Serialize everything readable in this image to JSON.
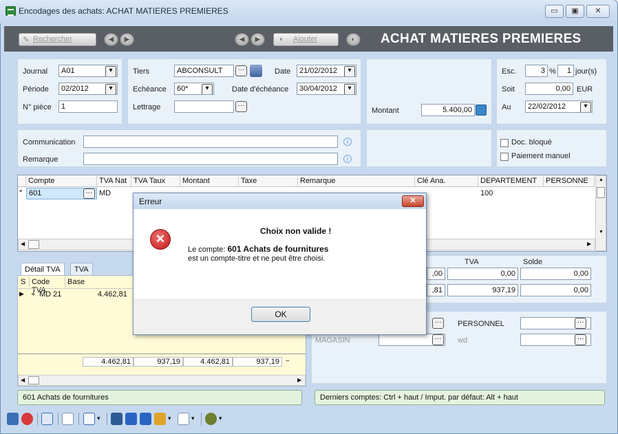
{
  "window": {
    "title": "Encodages des achats:  ACHAT MATIERES PREMIERES"
  },
  "toolbar": {
    "search_label": "Rechercher",
    "add_label": "Ajouter",
    "heading": "ACHAT MATIERES PREMIERES"
  },
  "form": {
    "journal_label": "Journal",
    "journal_value": "A01",
    "periode_label": "Période",
    "periode_value": "02/2012",
    "piece_label": "N° pièce",
    "piece_value": "1",
    "tiers_label": "Tiers",
    "tiers_value": "ABCONSULT",
    "echeance_label": "Echéance",
    "echeance_value": "60*",
    "lettrage_label": "Lettrage",
    "lettrage_value": "",
    "date_label": "Date",
    "date_value": "21/02/2012",
    "date_echeance_label": "Date d'échéance",
    "date_echeance_value": "30/04/2012",
    "montant_label": "Montant",
    "montant_value": "5.400,00",
    "esc_label": "Esc.",
    "esc_value": "3",
    "esc_unit": "%",
    "jour_value": "1",
    "jour_label": "jour(s)",
    "soit_label": "Soit",
    "soit_value": "0,00",
    "soit_unit": "EUR",
    "au_label": "Au",
    "au_value": "22/02/2012",
    "communication_label": "Communication",
    "remarque_label": "Remarque",
    "doc_bloque_label": "Doc. bloqué",
    "paiement_manuel_label": "Paiement manuel"
  },
  "grid": {
    "headers": [
      "Compte",
      "TVA Nat",
      "TVA Taux",
      "Montant",
      "Taxe",
      "Remarque",
      "Clé Ana.",
      "DEPARTEMENT",
      "PERSONNE"
    ],
    "row": {
      "marker": "*",
      "compte": "601",
      "tva_nat": "MD",
      "departement": "100"
    }
  },
  "tva_panel": {
    "tabs": [
      "Détail TVA",
      "TVA"
    ],
    "headers": [
      "S",
      "Code TVA",
      "Base"
    ],
    "row": {
      "s": "+",
      "code": "MD 21",
      "base": "4.462,81"
    },
    "totals": [
      "4.462,81",
      "937,19",
      "4.462,81",
      "937,19"
    ]
  },
  "summary": {
    "tva_label": "TVA",
    "solde_label": "Solde",
    "r1": [
      ",00",
      "0,00",
      "0,00"
    ],
    "r2": [
      ",81",
      "937,19",
      "0,00"
    ]
  },
  "analytics": {
    "magasin_label": "MAGASIN",
    "wd_label": "wd",
    "personnel_label": "PERSONNEL"
  },
  "status": {
    "left": "601  Achats de fournitures",
    "right": "Derniers comptes: Ctrl + haut / Imput. par défaut: Alt + haut"
  },
  "dialog": {
    "title": "Erreur",
    "heading": "Choix non valide !",
    "line1_prefix": "Le compte: ",
    "line1_bold": "601 Achats de fournitures",
    "line2": "est un compte-titre et ne peut être choisi.",
    "ok_label": "OK"
  },
  "colors": {
    "accent": "#5a5f66",
    "panel": "#e9f1f9",
    "error": "#d32f2f",
    "highlight": "#fffbd6"
  }
}
